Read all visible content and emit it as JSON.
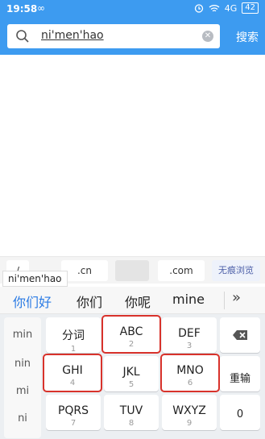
{
  "status_bar": {
    "time": "19:58",
    "link_icon": "∞",
    "signal_text": "4G",
    "battery": "42"
  },
  "search": {
    "query": "ni'men'hao",
    "button_label": "搜索"
  },
  "suggest_bar": {
    "chips": [
      "/",
      ".cn",
      ".com"
    ],
    "incognito_label": "无痕浏览",
    "pinyin_popup": "ni'men'hao"
  },
  "candidates": {
    "items": [
      "你们好",
      "你们",
      "你呢",
      "mine"
    ],
    "more_label": "»"
  },
  "keyboard": {
    "side_options": [
      "min",
      "nin",
      "mi",
      "ni"
    ],
    "keys": [
      {
        "label": "分词",
        "num": "1"
      },
      {
        "label": "ABC",
        "num": "2"
      },
      {
        "label": "DEF",
        "num": "3"
      },
      {
        "label": "GHI",
        "num": "4"
      },
      {
        "label": "JKL",
        "num": "5"
      },
      {
        "label": "MNO",
        "num": "6"
      },
      {
        "label": "PQRS",
        "num": "7"
      },
      {
        "label": "TUV",
        "num": "8"
      },
      {
        "label": "WXYZ",
        "num": "9"
      }
    ],
    "reset_label": "重输",
    "zero_label": "0"
  },
  "colors": {
    "header_bg": "#3d9bf0",
    "candidate_highlight": "#2b7be4",
    "highlight_box": "#d8322b"
  }
}
